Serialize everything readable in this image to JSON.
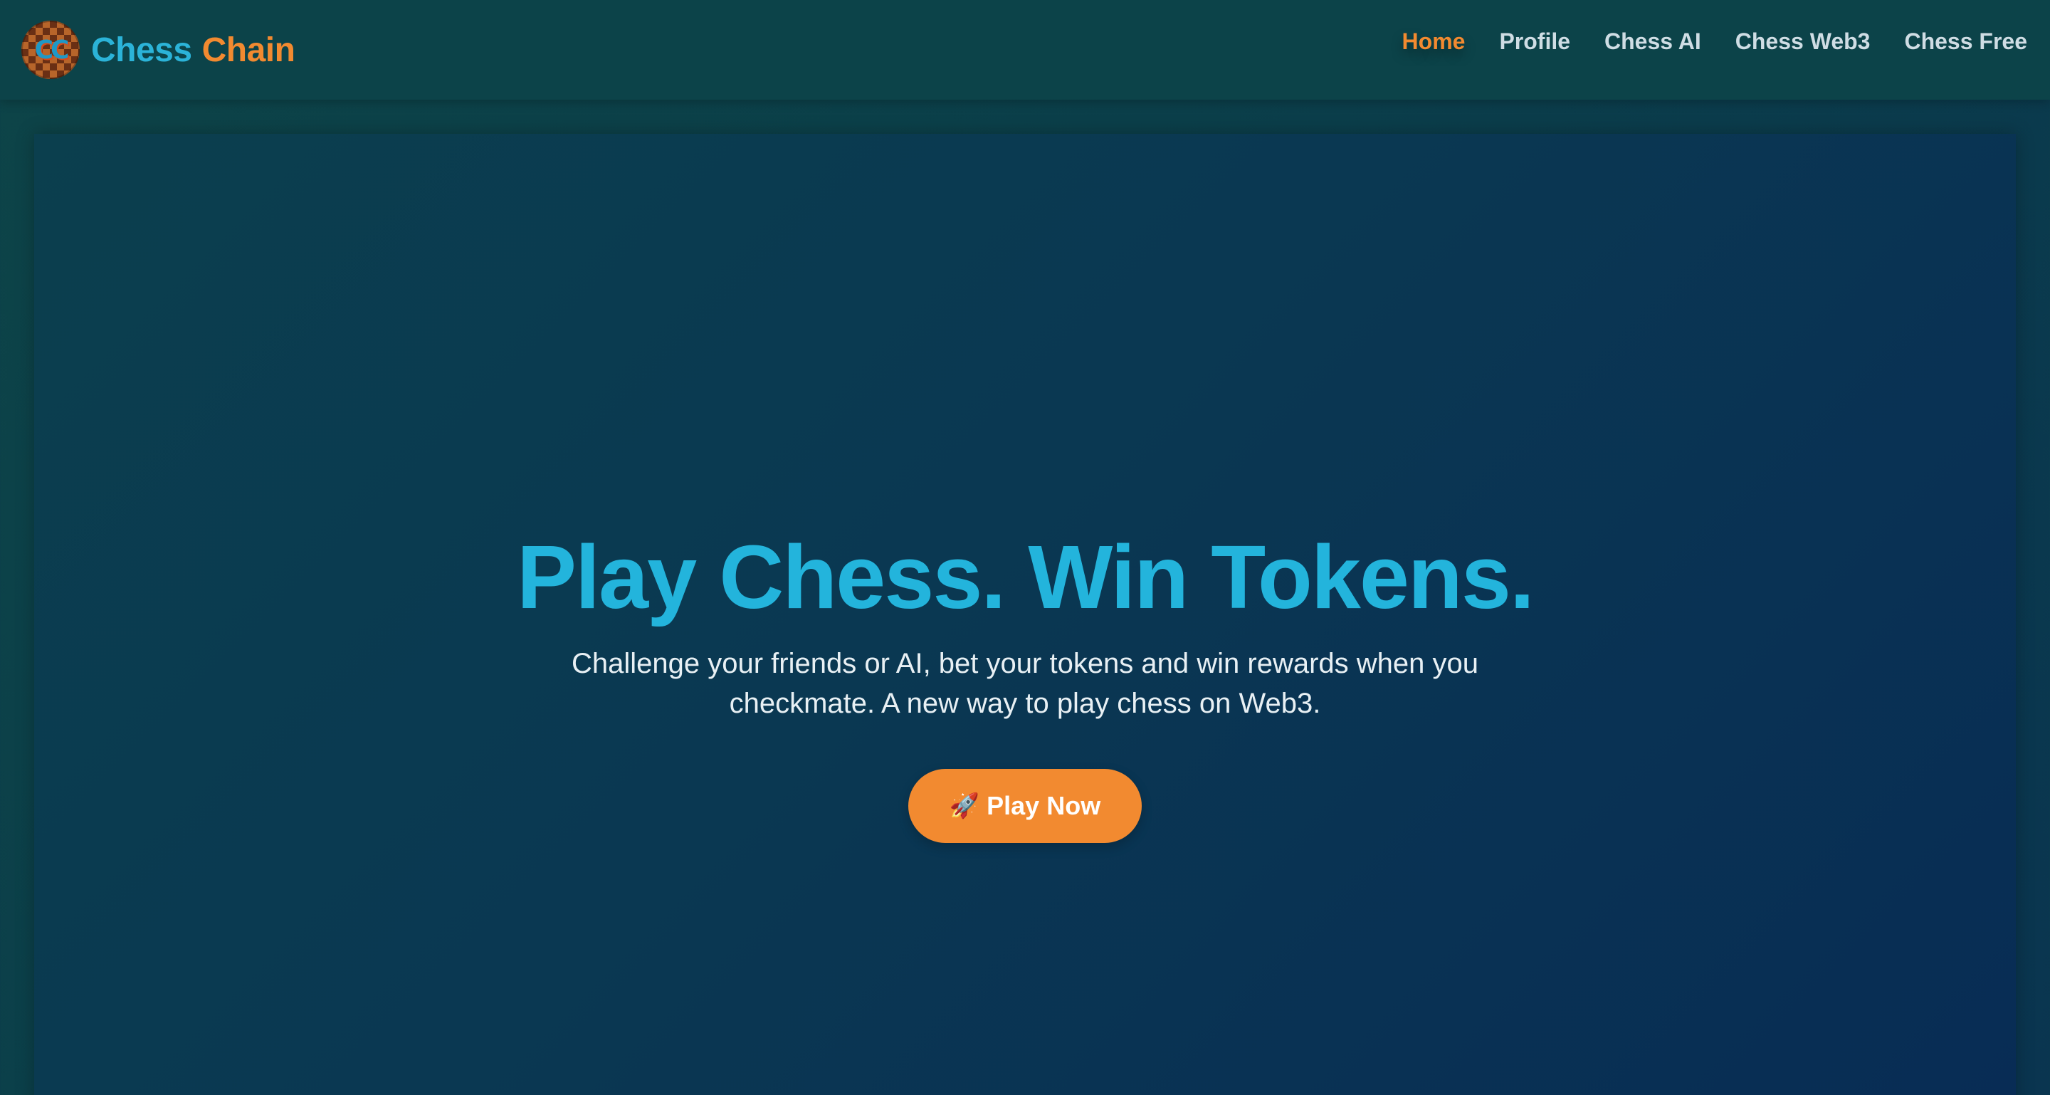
{
  "brand": {
    "logo_text": "CC",
    "name_part1": "Chess",
    "name_part2": "Chain"
  },
  "nav": {
    "items": [
      {
        "label": "Home",
        "active": true
      },
      {
        "label": "Profile",
        "active": false
      },
      {
        "label": "Chess AI",
        "active": false
      },
      {
        "label": "Chess Web3",
        "active": false
      },
      {
        "label": "Chess Free",
        "active": false
      }
    ]
  },
  "hero": {
    "title": "Play Chess. Win Tokens.",
    "subtitle": "Challenge your friends or AI, bet your tokens and win rewards when you checkmate. A new way to play chess on Web3.",
    "cta_icon": "🚀",
    "cta_label": "Play Now"
  },
  "colors": {
    "accent_orange": "#f28a30",
    "accent_cyan": "#23b4dc",
    "navbar_bg": "#0c4349",
    "hero_bg": "#0a3852"
  },
  "icons": {
    "logo": "chess-chain-logo-icon",
    "cta": "rocket-icon"
  }
}
